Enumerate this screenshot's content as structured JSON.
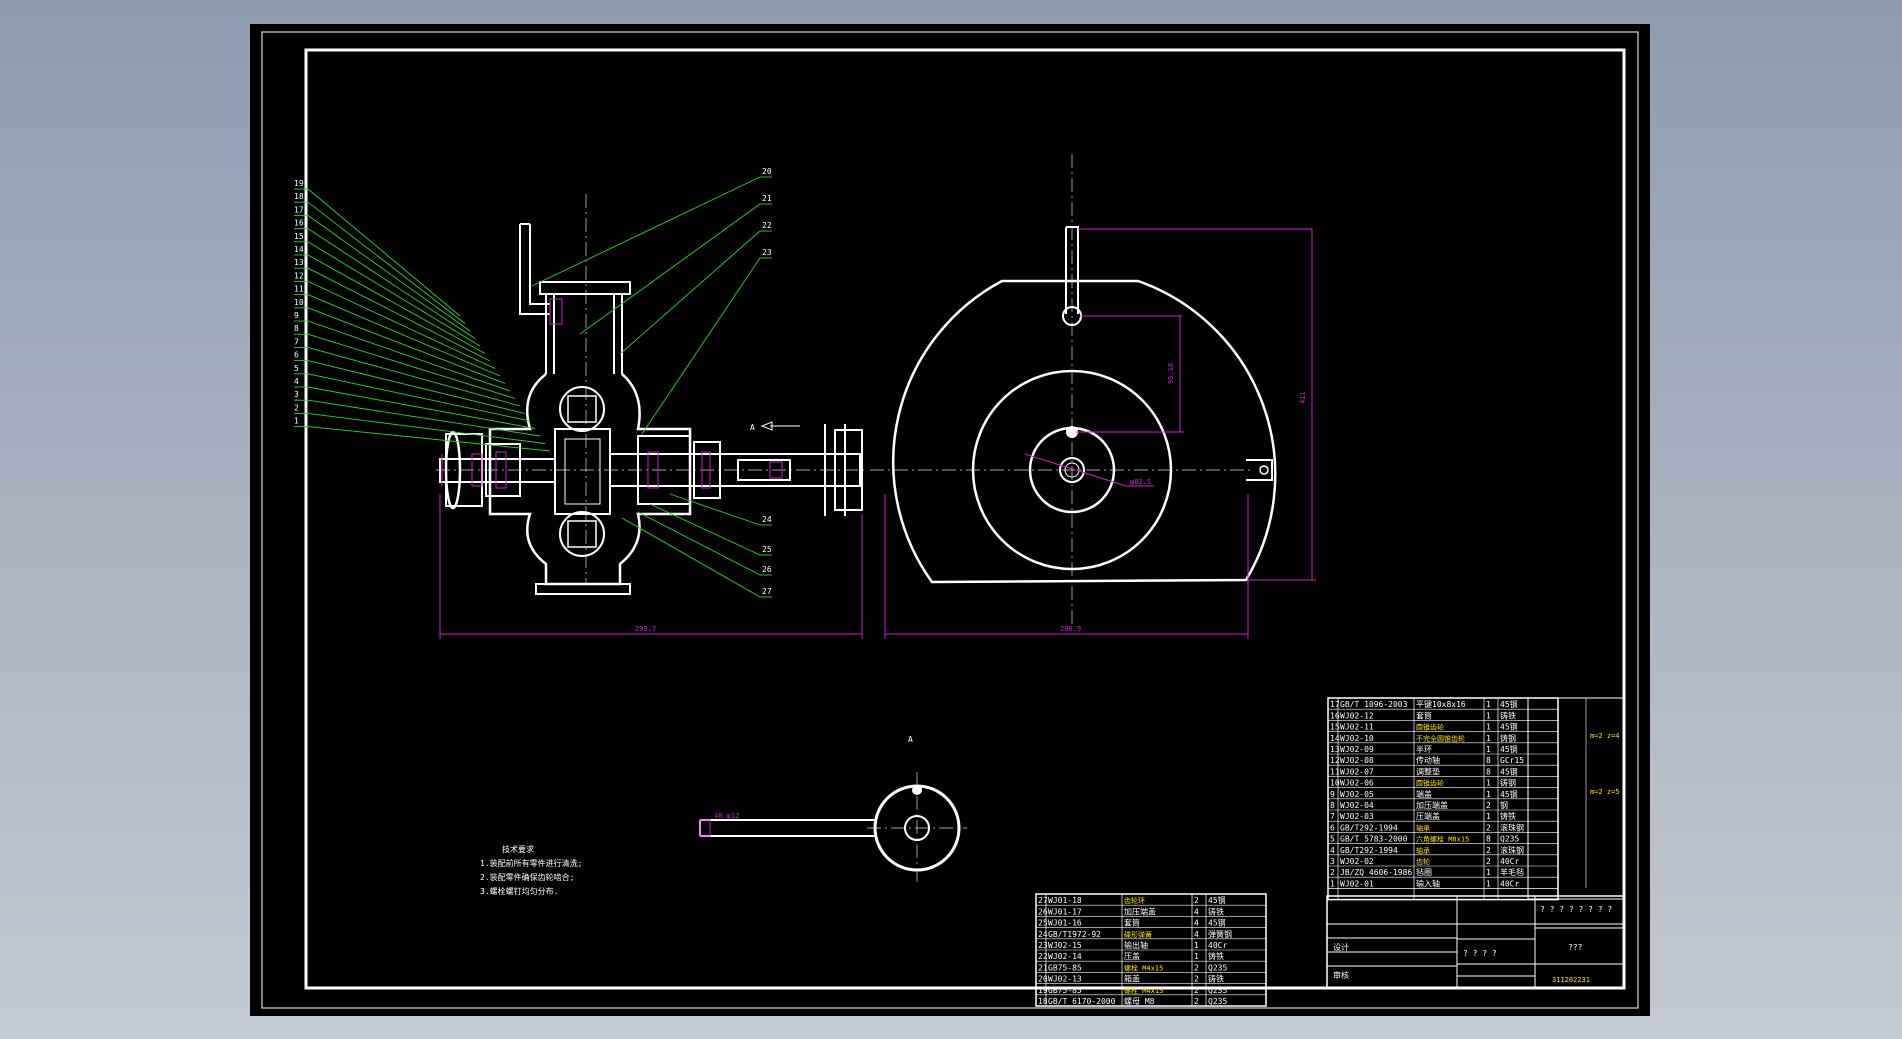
{
  "leader_labels_left": [
    "19",
    "18",
    "17",
    "16",
    "15",
    "14",
    "13",
    "12",
    "11",
    "10",
    "9",
    "8",
    "7",
    "6",
    "5",
    "4",
    "3",
    "2",
    "1"
  ],
  "leader_labels_right_top": [
    "20",
    "21",
    "22",
    "23"
  ],
  "leader_labels_right_bottom": [
    "24",
    "25",
    "26",
    "27"
  ],
  "section_arrow_label": "A",
  "section_view_label": "A",
  "dims": {
    "front_width": "293.7",
    "side_width": "286.9",
    "side_height": "411",
    "side_inner": "95.18",
    "hole_dia": "φ82.5",
    "handle_small": "48 φ12"
  },
  "tech_requirements": {
    "title": "技术要求",
    "items": [
      "1.装配前所有零件进行清洗;",
      "2.装配零件确保齿轮啮合;",
      "3.螺栓螺钉均匀分布."
    ]
  },
  "bom_right": [
    [
      "17",
      "GB/T 1096-2003",
      "平键10x8x16",
      "1",
      "45钢"
    ],
    [
      "16",
      "WJ02-12",
      "套筒",
      "1",
      "铸铁"
    ],
    [
      "15",
      "WJ02-11",
      "圆锥齿轮",
      "1",
      "45钢"
    ],
    [
      "14",
      "WJ02-10",
      "不完全圆锥齿轮",
      "1",
      "铸钢"
    ],
    [
      "13",
      "WJ02-09",
      "半环",
      "1",
      "45钢"
    ],
    [
      "12",
      "WJ02-08",
      "传动轴",
      "8",
      "GCr15"
    ],
    [
      "11",
      "WJ02-07",
      "调整垫",
      "8",
      "45钢"
    ],
    [
      "10",
      "WJ02-06",
      "圆锥齿轮",
      "1",
      "铸钢"
    ],
    [
      "9",
      "WJ02-05",
      "端盖",
      "1",
      "45钢"
    ],
    [
      "8",
      "WJ02-04",
      "加压端盖",
      "2",
      "钢"
    ],
    [
      "7",
      "WJ02-03",
      "压端盖",
      "1",
      "铸铁"
    ],
    [
      "6",
      "GB/T292-1994",
      "轴承",
      "2",
      "滚珠钢"
    ],
    [
      "5",
      "GB/T 5783-2000",
      "六角螺栓 M8x15",
      "8",
      "Q235"
    ],
    [
      "4",
      "GB/T292-1994",
      "轴承",
      "2",
      "滚珠钢"
    ],
    [
      "3",
      "WJ02-02",
      "齿轮",
      "2",
      "40Cr"
    ],
    [
      "2",
      "JB/ZQ 4606-1986",
      "毡圈",
      "1",
      "羊毛毡"
    ],
    [
      "1",
      "WJ02-01",
      "输入轴",
      "1",
      "40Cr"
    ]
  ],
  "bom_right_notes": [
    "m=2 z=4",
    "m=2 z=5"
  ],
  "bom_left": [
    [
      "27",
      "WJ01-18",
      "齿轮环",
      "2",
      "45钢"
    ],
    [
      "26",
      "WJ01-17",
      "加压端盖",
      "4",
      "铸铁"
    ],
    [
      "25",
      "WJ01-16",
      "套筒",
      "4",
      "45钢"
    ],
    [
      "24",
      "GB/T1972-92",
      "碟形弹簧",
      "4",
      "弹簧钢"
    ],
    [
      "23",
      "WJ02-15",
      "输出轴",
      "1",
      "40Cr"
    ],
    [
      "22",
      "WJ02-14",
      "压盖",
      "1",
      "铸铁"
    ],
    [
      "21",
      "GB75-85",
      "螺栓 M4x15",
      "2",
      "Q235"
    ],
    [
      "20",
      "WJ02-13",
      "箱盖",
      "2",
      "铸铁"
    ],
    [
      "19",
      "GB75-85",
      "螺栓 M4x15",
      "2",
      "Q235"
    ],
    [
      "18",
      "GB/T 6170-2000",
      "螺母 M8",
      "2",
      "Q235"
    ]
  ],
  "title_block": {
    "design": "设计",
    "review": "审核",
    "name_placeholder": "???",
    "scale_placeholder": "? ? ? ?",
    "drawing_number": "311202231",
    "header_placeholder": "? ? ? ? ? ? ? ?"
  },
  "colors": {
    "sheet": "#000000",
    "frame": "#ffffff",
    "leader": "#22dd22",
    "dimension": "#d020d0",
    "highlight": "#ffe000",
    "drawing_number": "#ffe000"
  }
}
